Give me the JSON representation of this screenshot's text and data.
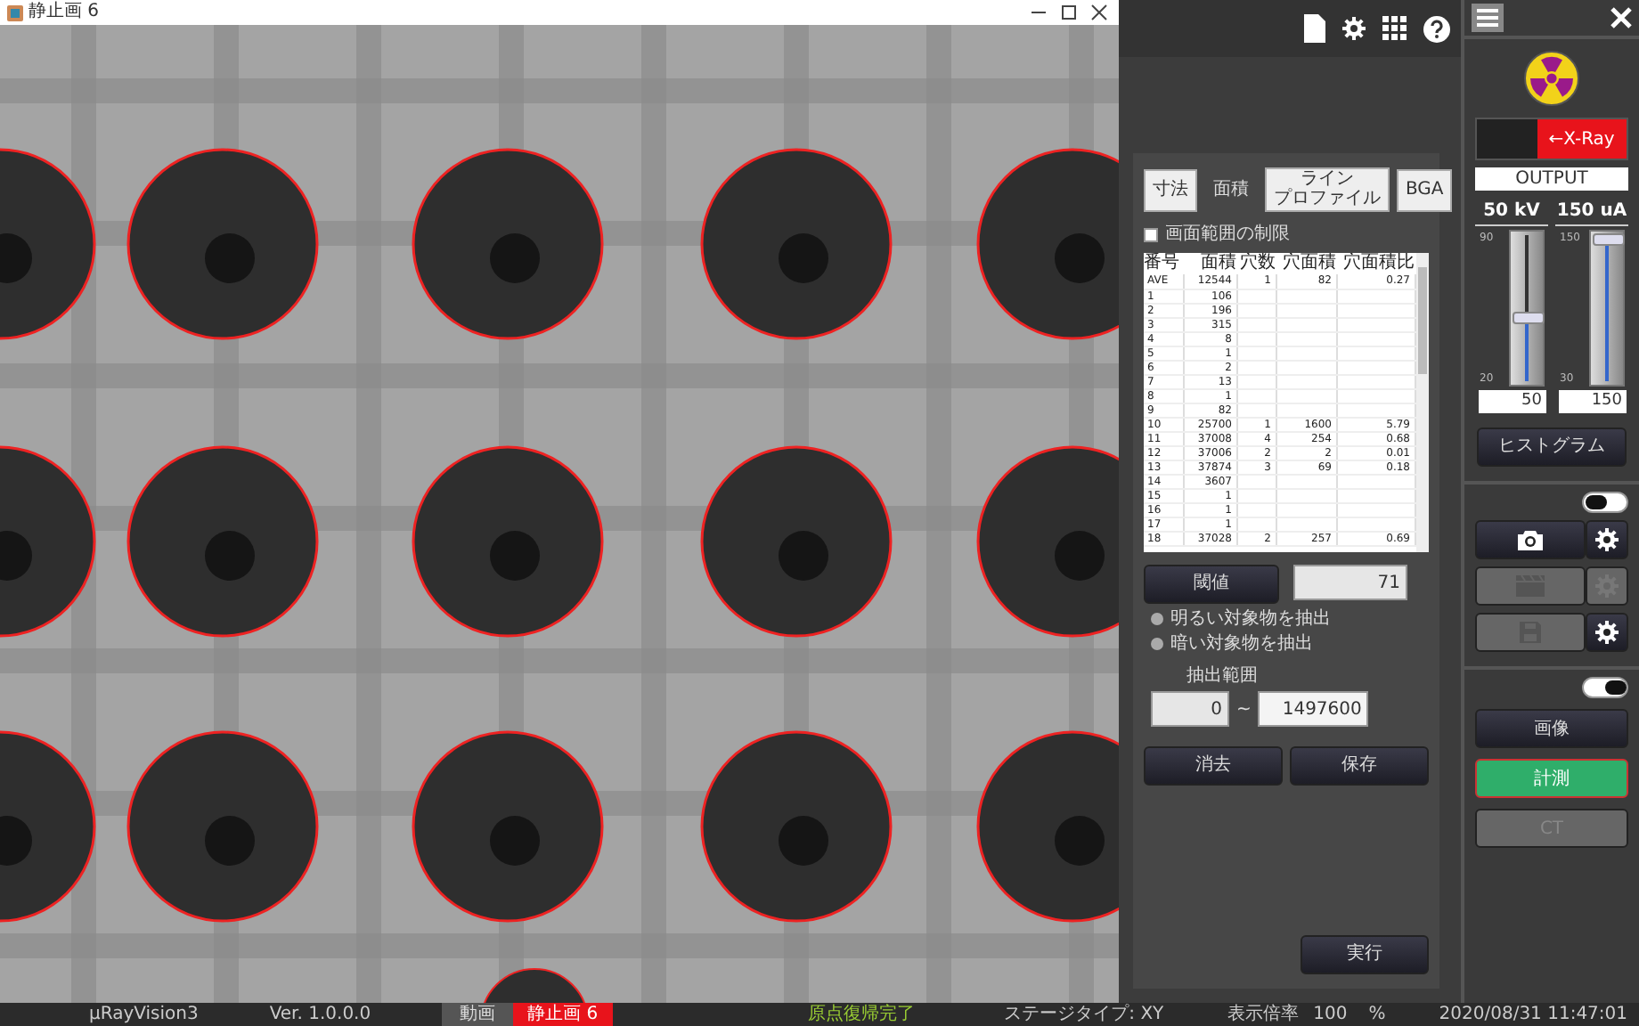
{
  "image_window": {
    "title": "静止画 6"
  },
  "analysis_panel": {
    "tabs": [
      {
        "label": "寸法",
        "selected": false
      },
      {
        "label": "面積",
        "selected": true
      },
      {
        "lines": [
          "ライン",
          "プロファイル"
        ],
        "selected": false
      },
      {
        "label": "BGA",
        "selected": false
      }
    ],
    "limit_checkbox": {
      "label": "画面範囲の制限",
      "checked": false
    },
    "table": {
      "columns": [
        "番号",
        "面積",
        "穴数",
        "穴面積",
        "穴面積比"
      ],
      "rows": [
        [
          "AVE",
          "12544",
          "1",
          "82",
          "0.27"
        ],
        [
          "1",
          "106",
          "",
          "",
          ""
        ],
        [
          "2",
          "196",
          "",
          "",
          ""
        ],
        [
          "3",
          "315",
          "",
          "",
          ""
        ],
        [
          "4",
          "8",
          "",
          "",
          ""
        ],
        [
          "5",
          "1",
          "",
          "",
          ""
        ],
        [
          "6",
          "2",
          "",
          "",
          ""
        ],
        [
          "7",
          "13",
          "",
          "",
          ""
        ],
        [
          "8",
          "1",
          "",
          "",
          ""
        ],
        [
          "9",
          "82",
          "",
          "",
          ""
        ],
        [
          "10",
          "25700",
          "1",
          "1600",
          "5.79"
        ],
        [
          "11",
          "37008",
          "4",
          "254",
          "0.68"
        ],
        [
          "12",
          "37006",
          "2",
          "2",
          "0.01"
        ],
        [
          "13",
          "37874",
          "3",
          "69",
          "0.18"
        ],
        [
          "14",
          "3607",
          "",
          "",
          ""
        ],
        [
          "15",
          "1",
          "",
          "",
          ""
        ],
        [
          "16",
          "1",
          "",
          "",
          ""
        ],
        [
          "17",
          "1",
          "",
          "",
          ""
        ],
        [
          "18",
          "37028",
          "2",
          "257",
          "0.69"
        ]
      ]
    },
    "threshold": {
      "button": "閾値",
      "value": "71"
    },
    "extract_options": [
      {
        "label": "明るい対象物を抽出",
        "selected": false
      },
      {
        "label": "暗い対象物を抽出",
        "selected": false
      }
    ],
    "range": {
      "label": "抽出範囲",
      "min": "0",
      "separator": "~",
      "max": "1497600"
    },
    "buttons": [
      "消去",
      "保存"
    ],
    "run_button": "実行"
  },
  "control_panel": {
    "xray_label": "←X-Ray",
    "output_label": "OUTPUT",
    "sliders": [
      {
        "label": "50 kV",
        "max_tick": "90",
        "min_tick": "20",
        "level": 0.43,
        "value": "50"
      },
      {
        "label": "150 uA",
        "max_tick": "150",
        "min_tick": "30",
        "level": 1.0,
        "value": "150"
      }
    ],
    "histogram_button": "ヒストグラム",
    "capture_toggle": {
      "on": false
    },
    "capture_rows": [
      {
        "kind": "camera",
        "disabled": false,
        "settings_disabled": false
      },
      {
        "kind": "video",
        "disabled": true,
        "settings_disabled": true
      },
      {
        "kind": "save",
        "disabled": true,
        "settings_disabled": false
      }
    ],
    "mode_toggle": {
      "on": true
    },
    "modes": [
      {
        "label": "画像",
        "selected": false,
        "disabled": false
      },
      {
        "label": "計測",
        "selected": true,
        "disabled": false
      },
      {
        "label": "CT",
        "selected": false,
        "disabled": true
      }
    ]
  },
  "status_bar": {
    "app": "μRayVision3",
    "version": "Ver. 1.0.0.0",
    "tabs": [
      {
        "label": "動画",
        "selected": false
      },
      {
        "label": "静止画 6",
        "selected": true
      }
    ],
    "message": "原点復帰完了",
    "stage": "ステージタイプ:  XY",
    "zoom_label": "表示倍率",
    "zoom_value": "100",
    "zoom_unit": "%",
    "datetime": "2020/08/31 11:47:01"
  }
}
